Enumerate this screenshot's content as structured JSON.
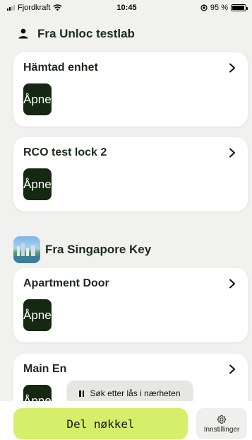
{
  "status_bar": {
    "carrier": "Fjordkraft",
    "time": "10:45",
    "battery_label": "95 %",
    "battery_level": 0.95,
    "icons": [
      "signal-icon",
      "wifi-icon",
      "orientation-lock-icon",
      "battery-icon"
    ]
  },
  "sections": [
    {
      "title": "Fra Unloc testlab",
      "icon": "person-icon",
      "locks": [
        {
          "name": "Hämtad enhet",
          "open_label": "Åpne"
        },
        {
          "name": "RCO test lock 2",
          "open_label": "Åpne"
        }
      ]
    },
    {
      "title": "Fra Singapore Key",
      "icon": "singapore-avatar",
      "locks": [
        {
          "name": "Apartment Door",
          "open_label": "Åpne"
        },
        {
          "name": "Main En",
          "open_label": "Åpne"
        }
      ]
    }
  ],
  "toast": {
    "label": "Søk etter lås i nærheten",
    "icon": "pause-icon"
  },
  "bottom_bar": {
    "share_label": "Del nøkkel",
    "settings_label": "Innstillinger",
    "settings_icon": "gear-icon"
  },
  "colors": {
    "background": "#f1f1ef",
    "open_button": "#152811",
    "share_button": "#d5ef6a",
    "card": "#ffffff"
  }
}
